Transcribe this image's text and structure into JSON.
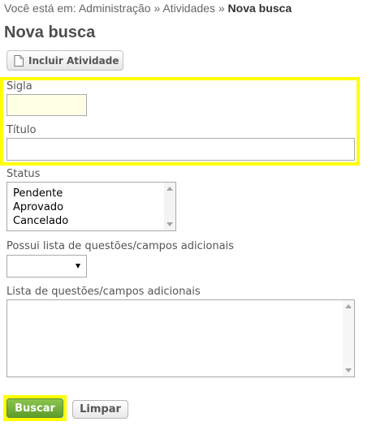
{
  "breadcrumb": {
    "prefix": "Você está em:",
    "items": [
      "Administração",
      "Atividades"
    ],
    "separator": "»",
    "current": "Nova busca"
  },
  "page_title": "Nova busca",
  "toolbar": {
    "include_button_label": "Incluir Atividade",
    "include_button_icon": "document-icon"
  },
  "form": {
    "sigla": {
      "label": "Sigla",
      "value": "",
      "background": "#ffffe6"
    },
    "titulo": {
      "label": "Título",
      "value": ""
    },
    "status": {
      "label": "Status",
      "options": [
        "Pendente",
        "Aprovado",
        "Cancelado"
      ]
    },
    "possui_lista": {
      "label": "Possui lista de questões/campos adicionais",
      "selected": ""
    },
    "lista": {
      "label": "Lista de questões/campos adicionais",
      "value": ""
    }
  },
  "actions": {
    "search_label": "Buscar",
    "clear_label": "Limpar"
  },
  "colors": {
    "highlight": "#ffff00",
    "primary_button": "#6aaa35"
  }
}
